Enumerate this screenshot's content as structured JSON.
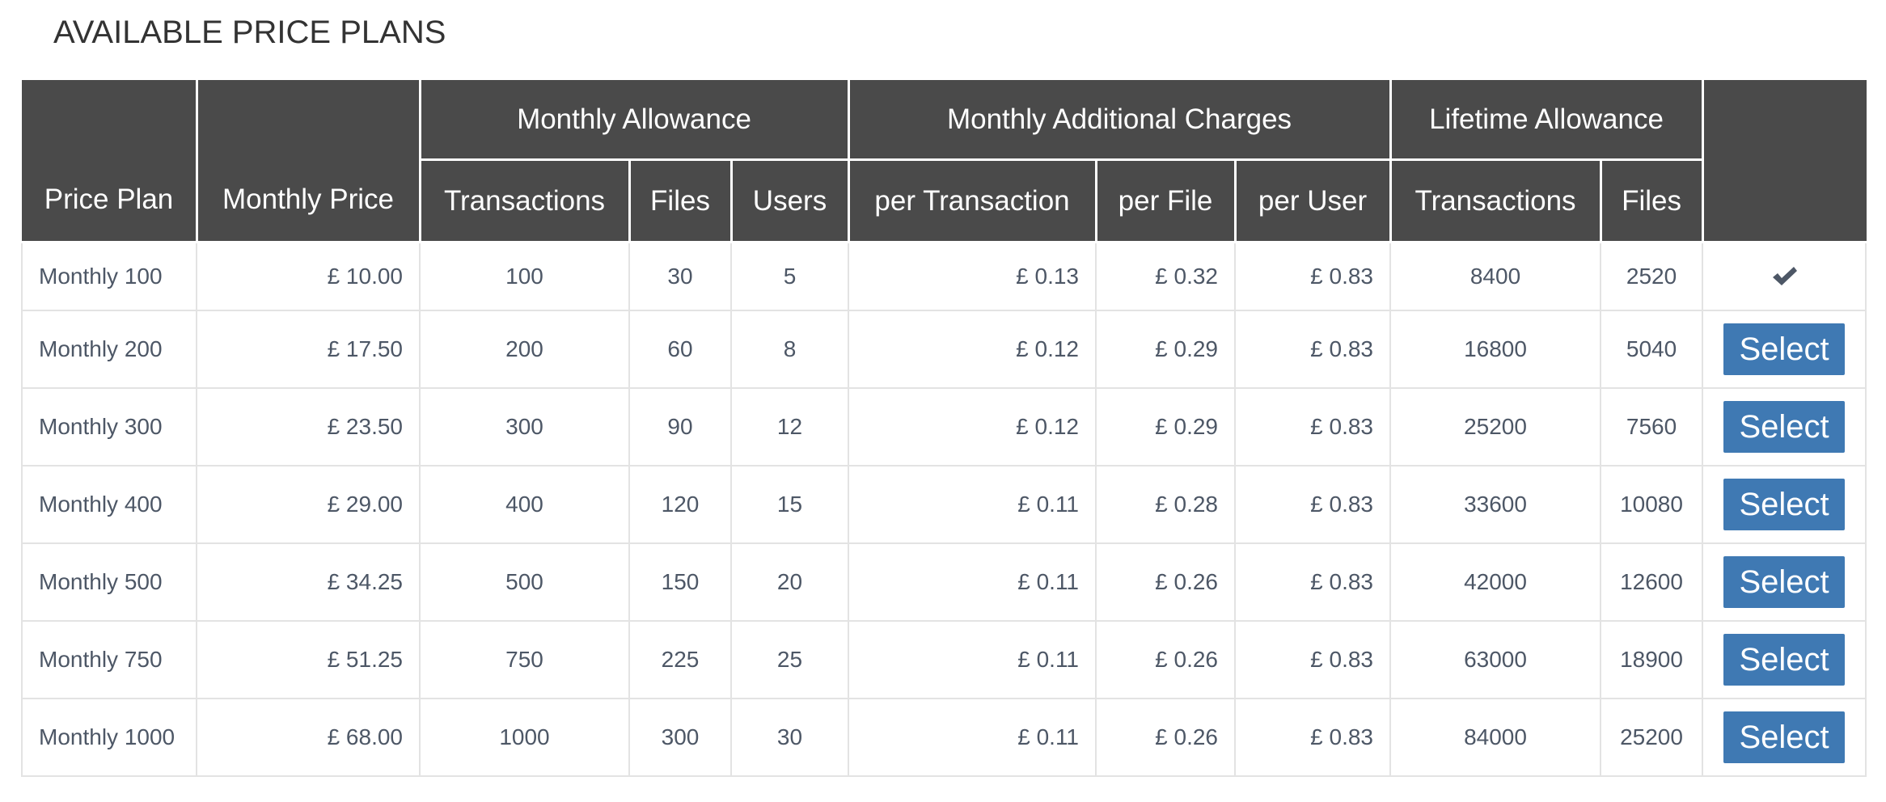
{
  "page": {
    "title": "AVAILABLE PRICE PLANS"
  },
  "table": {
    "group_headers": {
      "price_plan": "Price Plan",
      "monthly_price": "Monthly Price",
      "monthly_allowance": "Monthly Allowance",
      "monthly_additional_charges": "Monthly Additional Charges",
      "lifetime_allowance": "Lifetime Allowance"
    },
    "sub_headers": {
      "ma_transactions": "Transactions",
      "ma_files": "Files",
      "ma_users": "Users",
      "mac_per_transaction": "per Transaction",
      "mac_per_file": "per File",
      "mac_per_user": "per User",
      "la_transactions": "Transactions",
      "la_files": "Files"
    },
    "rows": [
      {
        "plan": "Monthly 100",
        "price": "£ 10.00",
        "ma_transactions": "100",
        "ma_files": "30",
        "ma_users": "5",
        "per_transaction": "£ 0.13",
        "per_file": "£ 0.32",
        "per_user": "£ 0.83",
        "la_transactions": "8400",
        "la_files": "2520",
        "action": "current",
        "action_icon": "check-icon"
      },
      {
        "plan": "Monthly 200",
        "price": "£ 17.50",
        "ma_transactions": "200",
        "ma_files": "60",
        "ma_users": "8",
        "per_transaction": "£ 0.12",
        "per_file": "£ 0.29",
        "per_user": "£ 0.83",
        "la_transactions": "16800",
        "la_files": "5040",
        "action": "Select"
      },
      {
        "plan": "Monthly 300",
        "price": "£ 23.50",
        "ma_transactions": "300",
        "ma_files": "90",
        "ma_users": "12",
        "per_transaction": "£ 0.12",
        "per_file": "£ 0.29",
        "per_user": "£ 0.83",
        "la_transactions": "25200",
        "la_files": "7560",
        "action": "Select"
      },
      {
        "plan": "Monthly 400",
        "price": "£ 29.00",
        "ma_transactions": "400",
        "ma_files": "120",
        "ma_users": "15",
        "per_transaction": "£ 0.11",
        "per_file": "£ 0.28",
        "per_user": "£ 0.83",
        "la_transactions": "33600",
        "la_files": "10080",
        "action": "Select"
      },
      {
        "plan": "Monthly 500",
        "price": "£ 34.25",
        "ma_transactions": "500",
        "ma_files": "150",
        "ma_users": "20",
        "per_transaction": "£ 0.11",
        "per_file": "£ 0.26",
        "per_user": "£ 0.83",
        "la_transactions": "42000",
        "la_files": "12600",
        "action": "Select"
      },
      {
        "plan": "Monthly 750",
        "price": "£ 51.25",
        "ma_transactions": "750",
        "ma_files": "225",
        "ma_users": "25",
        "per_transaction": "£ 0.11",
        "per_file": "£ 0.26",
        "per_user": "£ 0.83",
        "la_transactions": "63000",
        "la_files": "18900",
        "action": "Select"
      },
      {
        "plan": "Monthly 1000",
        "price": "£ 68.00",
        "ma_transactions": "1000",
        "ma_files": "300",
        "ma_users": "30",
        "per_transaction": "£ 0.11",
        "per_file": "£ 0.26",
        "per_user": "£ 0.83",
        "la_transactions": "84000",
        "la_files": "25200",
        "action": "Select"
      }
    ]
  },
  "colors": {
    "header_bg": "#4a4a4a",
    "header_text": "#ffffff",
    "cell_text": "#4d5766",
    "select_button_bg": "#3f79b3",
    "border": "#e3e3e3"
  }
}
